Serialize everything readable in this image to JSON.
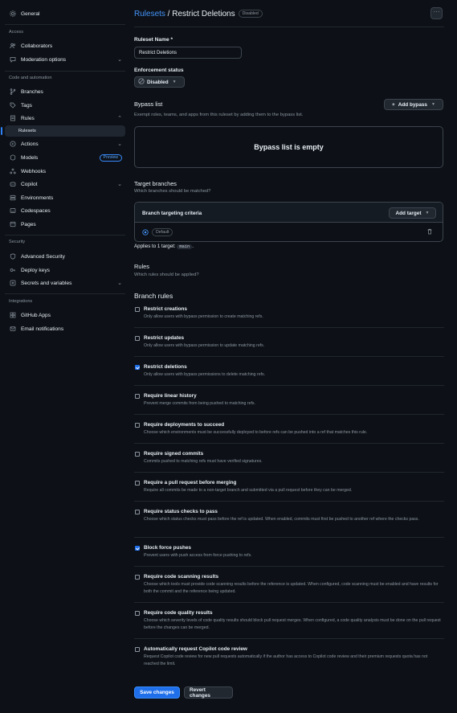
{
  "sidebar": {
    "general": "General",
    "sections": {
      "access": "Access",
      "code_automation": "Code and automation",
      "security": "Security",
      "integrations": "Integrations"
    },
    "items": {
      "collaborators": "Collaborators",
      "moderation": "Moderation options",
      "branches": "Branches",
      "tags": "Tags",
      "rules": "Rules",
      "rulesets": "Rulesets",
      "actions": "Actions",
      "models": "Models",
      "models_badge": "Preview",
      "webhooks": "Webhooks",
      "copilot": "Copilot",
      "environments": "Environments",
      "codespaces": "Codespaces",
      "pages": "Pages",
      "advanced_security": "Advanced Security",
      "deploy_keys": "Deploy keys",
      "secrets": "Secrets and variables",
      "github_apps": "GitHub Apps",
      "email_notifications": "Email notifications"
    }
  },
  "header": {
    "breadcrumb_link": "Rulesets",
    "separator": " / ",
    "name": "Restrict Deletions",
    "status_badge": "Disabled",
    "more": "···"
  },
  "form": {
    "ruleset_name_label": "Ruleset Name *",
    "ruleset_name_value": "Restrict Deletions",
    "enforcement_label": "Enforcement status",
    "enforcement_value": "Disabled",
    "bypass_title": "Bypass list",
    "bypass_desc": "Exempt roles, teams, and apps from this ruleset by adding them to the bypass list.",
    "add_bypass": "Add bypass",
    "bypass_empty": "Bypass list is empty",
    "target_title": "Target branches",
    "target_desc": "Which branches should be matched?",
    "criteria_title": "Branch targeting criteria",
    "add_target": "Add target",
    "default_tag": "Default",
    "applies_prefix": "Applies to 1 target:",
    "applies_code": "main",
    "applies_suffix": ".",
    "rules_title": "Rules",
    "rules_desc": "Which rules should be applied?",
    "branch_rules_title": "Branch rules"
  },
  "rules": [
    {
      "title": "Restrict creations",
      "desc": "Only allow users with bypass permission to create matching refs.",
      "checked": false
    },
    {
      "title": "Restrict updates",
      "desc": "Only allow users with bypass permission to update matching refs.",
      "checked": false
    },
    {
      "title": "Restrict deletions",
      "desc": "Only allow users with bypass permissions to delete matching refs.",
      "checked": true
    },
    {
      "title": "Require linear history",
      "desc": "Prevent merge commits from being pushed to matching refs.",
      "checked": false
    },
    {
      "title": "Require deployments to succeed",
      "desc": "Choose which environments must be successfully deployed to before refs can be pushed into a ref that matches this rule.",
      "checked": false
    },
    {
      "title": "Require signed commits",
      "desc": "Commits pushed to matching refs must have verified signatures.",
      "checked": false
    },
    {
      "title": "Require a pull request before merging",
      "desc": "Require all commits be made to a non-target branch and submitted via a pull request before they can be merged.",
      "checked": false
    },
    {
      "title": "Require status checks to pass",
      "desc": "Choose which status checks must pass before the ref is updated. When enabled, commits must first be pushed to another ref where the checks pass.",
      "checked": false
    },
    {
      "title": "Block force pushes",
      "desc": "Prevent users with push access from force pushing to refs.",
      "checked": true
    },
    {
      "title": "Require code scanning results",
      "desc": "Choose which tools must provide code scanning results before the reference is updated. When configured, code scanning must be enabled and have results for both the commit and the reference being updated.",
      "checked": false
    },
    {
      "title": "Require code quality results",
      "desc": "Choose which severity levels of code quality results should block pull request merges. When configured, a code quality analysis must be done on the pull request before the changes can be merged.",
      "checked": false
    },
    {
      "title": "Automatically request Copilot code review",
      "desc": "Request Copilot code review for new pull requests automatically if the author has access to Copilot code review and their premium requests quota has not reached the limit.",
      "checked": false
    }
  ],
  "footer": {
    "save": "Save changes",
    "revert": "Revert changes"
  },
  "colors": {
    "background": "#0d1117",
    "accent": "#1f6feb",
    "link": "#4493f8",
    "muted": "#8b949e"
  }
}
